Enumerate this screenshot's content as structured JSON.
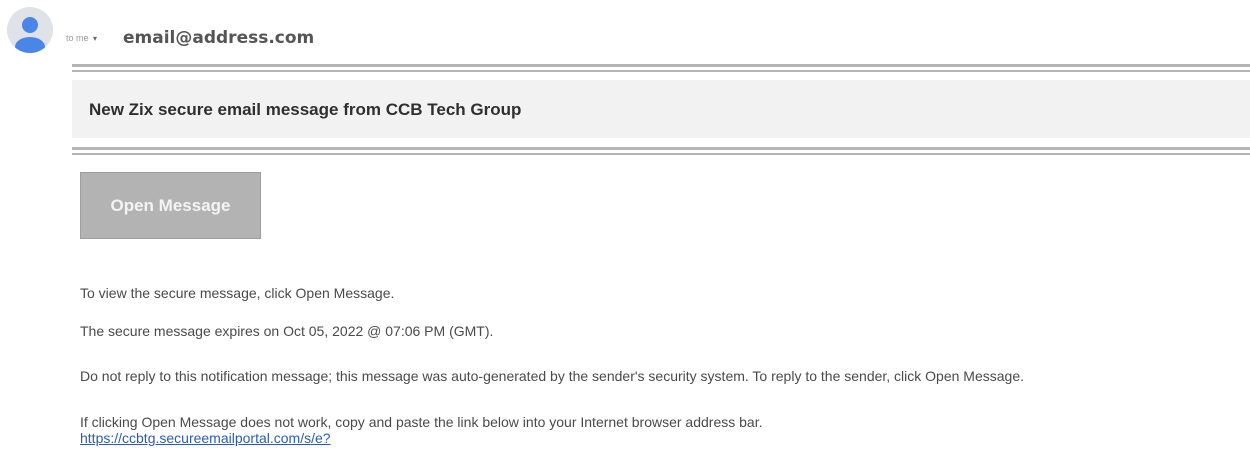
{
  "header": {
    "recipient_label": "to me",
    "caret": "▾",
    "sender_email": "email@address.com"
  },
  "banner": {
    "title": "New Zix secure email message from CCB Tech Group"
  },
  "button": {
    "label": "Open Message"
  },
  "body": {
    "line1": "To view the secure message, click Open Message.",
    "line2": "The secure message expires on Oct 05, 2022 @ 07:06 PM (GMT).",
    "line3": "Do not reply to this notification message; this message was auto-generated by the sender's security system. To reply to the sender, click Open Message.",
    "line4": "If clicking Open Message does not work, copy and paste the link below into your Internet browser address bar.",
    "link": "https://ccbtg.secureemailportal.com/s/e?"
  },
  "icons": {
    "avatar": "person-avatar-icon",
    "caret": "caret-down-icon"
  },
  "colors": {
    "avatar_bg": "#dfe3e8",
    "avatar_fg": "#4a86e8",
    "banner_bg": "#f2f2f2",
    "rule": "#b5b5b5",
    "button_bg": "#b3b3b3",
    "link": "#2a5db0"
  }
}
